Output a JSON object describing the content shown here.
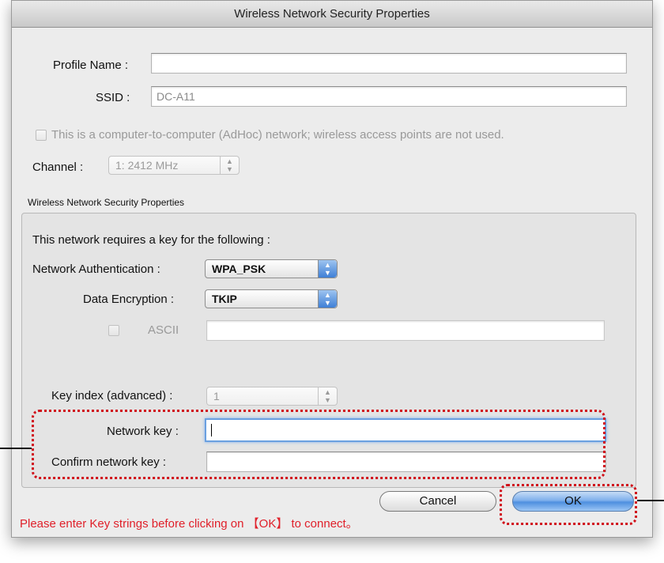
{
  "window": {
    "title": "Wireless Network Security Properties"
  },
  "profile": {
    "name_label": "Profile Name :",
    "name_value": "",
    "ssid_label": "SSID :",
    "ssid_value": "DC-A11"
  },
  "adhoc": {
    "label": "This is a computer-to-computer (AdHoc) network; wireless access points are not used.",
    "checked": false
  },
  "channel": {
    "label": "Channel :",
    "value": "1: 2412 MHz"
  },
  "security": {
    "group_title": "Wireless Network Security Properties",
    "heading": "This network requires a key for the following :",
    "auth_label": "Network Authentication :",
    "auth_value": "WPA_PSK",
    "encryption_label": "Data Encryption :",
    "encryption_value": "TKIP",
    "ascii_label": "ASCII",
    "ascii_value": "",
    "key_index_label": "Key index (advanced) :",
    "key_index_value": "1",
    "network_key_label": "Network key :",
    "network_key_value": "",
    "confirm_key_label": "Confirm network key :",
    "confirm_key_value": ""
  },
  "buttons": {
    "cancel": "Cancel",
    "ok": "OK"
  },
  "hint": "Please enter Key strings before clicking on 【OK】 to connect。",
  "colors": {
    "highlight": "#d0101a",
    "hint_text": "#e0202a",
    "default_button": "#4e8fe0"
  }
}
